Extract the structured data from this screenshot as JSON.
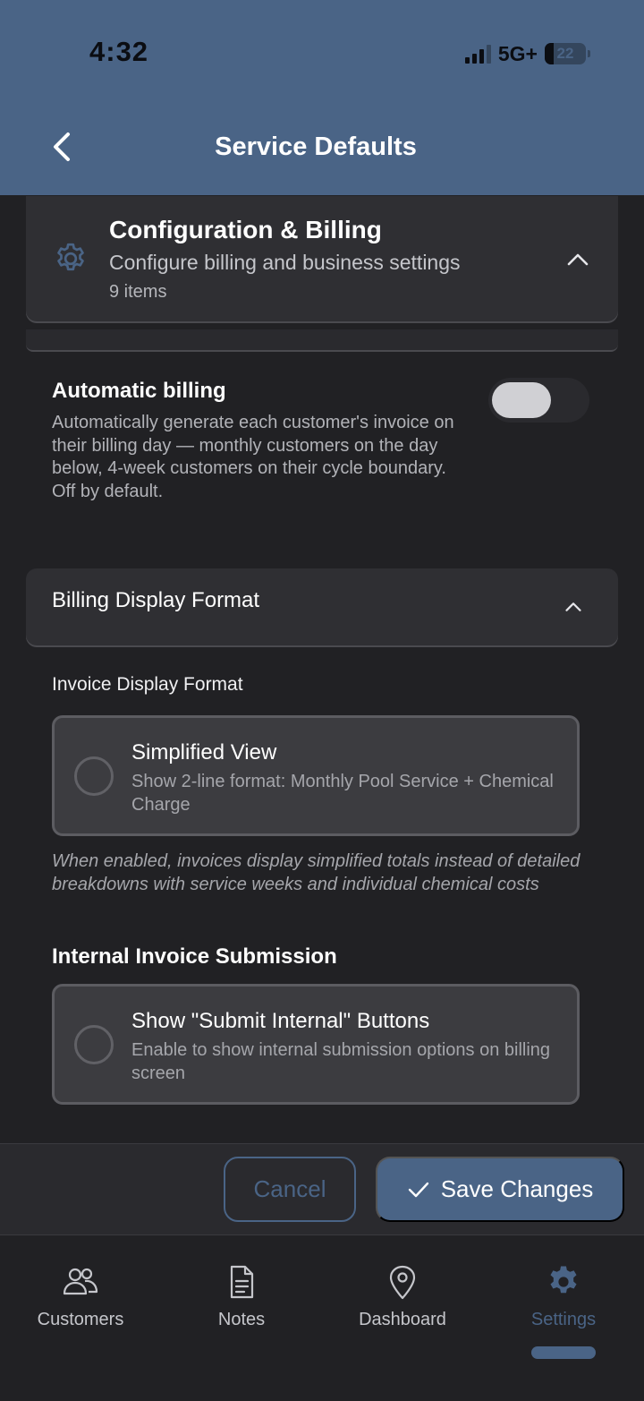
{
  "status_bar": {
    "time": "4:32",
    "network": "5G+",
    "battery_level": "22"
  },
  "header": {
    "title": "Service Defaults",
    "back_icon": "chevron-left-icon"
  },
  "config_section": {
    "icon": "gear-icon",
    "title": "Configuration & Billing",
    "subtitle": "Configure billing and business settings",
    "count": "9 items",
    "expanded": true
  },
  "automatic_billing": {
    "title": "Automatic billing",
    "description": "Automatically generate each customer's invoice on their billing day — monthly customers on the day below, 4-week customers on their cycle boundary. Off by default.",
    "enabled": false
  },
  "billing_display": {
    "title": "Billing Display Format",
    "expanded": true,
    "invoice_label": "Invoice Display Format",
    "simplified_option": {
      "title": "Simplified View",
      "description": "Show 2-line format: Monthly Pool Service + Chemical Charge",
      "selected": false
    },
    "note": "When enabled, invoices display simplified totals instead of detailed breakdowns with service weeks and individual chemical costs",
    "internal_title": "Internal Invoice Submission",
    "internal_option": {
      "title": "Show \"Submit Internal\" Buttons",
      "description": "Enable to show internal submission options on billing screen",
      "selected": false
    }
  },
  "actions": {
    "cancel_label": "Cancel",
    "save_label": "Save Changes"
  },
  "tabs": [
    {
      "label": "Customers",
      "icon": "users-icon",
      "active": false
    },
    {
      "label": "Notes",
      "icon": "document-icon",
      "active": false
    },
    {
      "label": "Dashboard",
      "icon": "map-pin-icon",
      "active": false
    },
    {
      "label": "Settings",
      "icon": "gear-icon",
      "active": true
    }
  ],
  "colors": {
    "accent": "#4a6486",
    "background": "#212124",
    "card": "#2f2f33"
  }
}
